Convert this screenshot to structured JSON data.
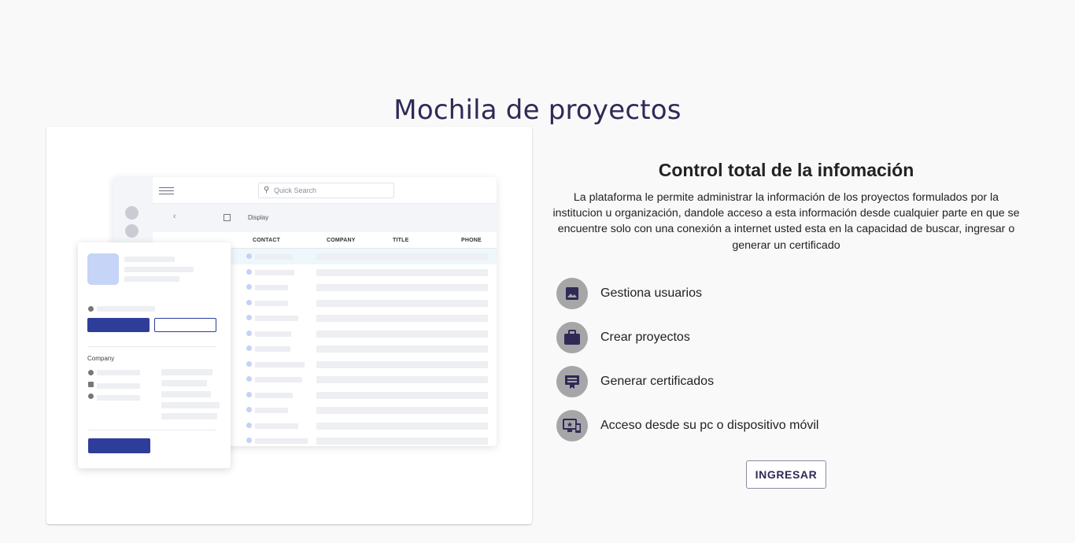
{
  "page": {
    "title": "Mochila de proyectos"
  },
  "illustration": {
    "search_placeholder": "Quick Search",
    "display_label": "Display",
    "columns": [
      "CONTACT",
      "COMPANY",
      "TITLE",
      "PHONE"
    ],
    "company_label": "Company"
  },
  "info": {
    "subtitle": "Control total de la infomación",
    "description": "La plataforma le permite administrar la información de los proyectos formulados por la institucion u organización, dandole acceso a esta información desde cualquier parte en que se encuentre solo con una conexión a internet usted esta en la capacidad de buscar, ingresar o generar un certificado"
  },
  "features": [
    {
      "icon": "image-icon",
      "label": "Gestiona usuarios"
    },
    {
      "icon": "briefcase-icon",
      "label": "Crear proyectos"
    },
    {
      "icon": "certificate-icon",
      "label": "Generar certificados"
    },
    {
      "icon": "devices-icon",
      "label": "Acceso desde su pc o dispositivo móvil"
    }
  ],
  "actions": {
    "login_label": "INGRESAR"
  },
  "colors": {
    "title": "#2e2a55",
    "icon_circle": "#a6a6a8",
    "icon_glyph": "#2e2a55",
    "mock_primary": "#2f3d9a"
  }
}
